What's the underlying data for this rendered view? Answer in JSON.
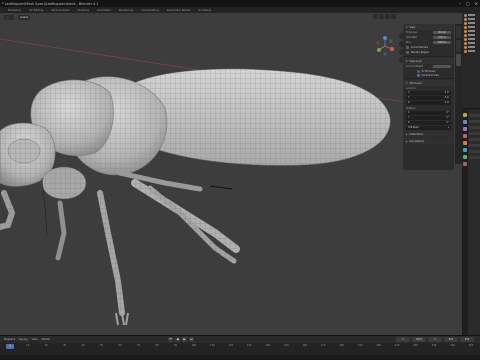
{
  "window": {
    "title": "* Leafhopper(Mesh Spec)\\Leafhopper.blend - Blender 4.1",
    "controls": [
      "–",
      "▢",
      "✕"
    ]
  },
  "workspaces": [
    {
      "label": "Modeling",
      "active": false
    },
    {
      "label": "UV Editing",
      "active": false
    },
    {
      "label": "Texture Paint",
      "active": false
    },
    {
      "label": "Shading",
      "active": false
    },
    {
      "label": "Animation",
      "active": false
    },
    {
      "label": "Rendering",
      "active": false
    },
    {
      "label": "Compositing",
      "active": false
    },
    {
      "label": "Geometry Nodes",
      "active": false
    },
    {
      "label": "Scripting",
      "active": false
    }
  ],
  "viewport": {
    "transform_orientation": "Global",
    "axes": {
      "x": "X",
      "y": "Y",
      "z": "Z"
    }
  },
  "npanel": {
    "view_section": "View",
    "focal_length_label": "Focal Len",
    "focal_length_value": "50 mm",
    "clip_start_label": "Clip Start",
    "clip_start_value": "0.01 m",
    "clip_end_label": "End",
    "clip_end_value": "1000 m",
    "local_camera_label": "Local Camera",
    "render_region_label": "Render Region",
    "view_lock_label": "View Lock",
    "lock_to_object_label": "Lock to Object",
    "lock_label": "Lock",
    "lock_opt_3d_cursor": "To 3D Cursor",
    "lock_opt_camera": "Camera to View",
    "cursor_section": "3D Cursor",
    "location_label": "Location",
    "cursor_x": "0 m",
    "cursor_y": "0 m",
    "cursor_z": "0 m",
    "rotation_label": "Rotation",
    "rot_x": "0°",
    "rot_y": "0°",
    "rot_z": "0°",
    "rotation_mode": "XYZ Euler",
    "collections_section": "Collections",
    "annotations_section": "Annotations"
  },
  "timeline": {
    "playback_label": "Playback",
    "keying_label": "Keying",
    "view_label": "View",
    "marker_label": "Marker",
    "transport": [
      "⏮",
      "◀",
      "▶",
      "⏭"
    ],
    "current_frame": "1",
    "start_label": "Start",
    "start_value": "1",
    "end_label": "End",
    "end_value": "250",
    "ruler": [
      "1",
      "10",
      "20",
      "30",
      "40",
      "50",
      "60",
      "70",
      "80",
      "90",
      "100",
      "110",
      "120",
      "130",
      "140",
      "150",
      "160",
      "170",
      "180",
      "190",
      "200",
      "210",
      "220",
      "230",
      "240",
      "250"
    ]
  },
  "colors": {
    "viewport_bg": "#3d3d3d",
    "accent": "#4772b3",
    "model_fill": "#c9c9c9"
  }
}
